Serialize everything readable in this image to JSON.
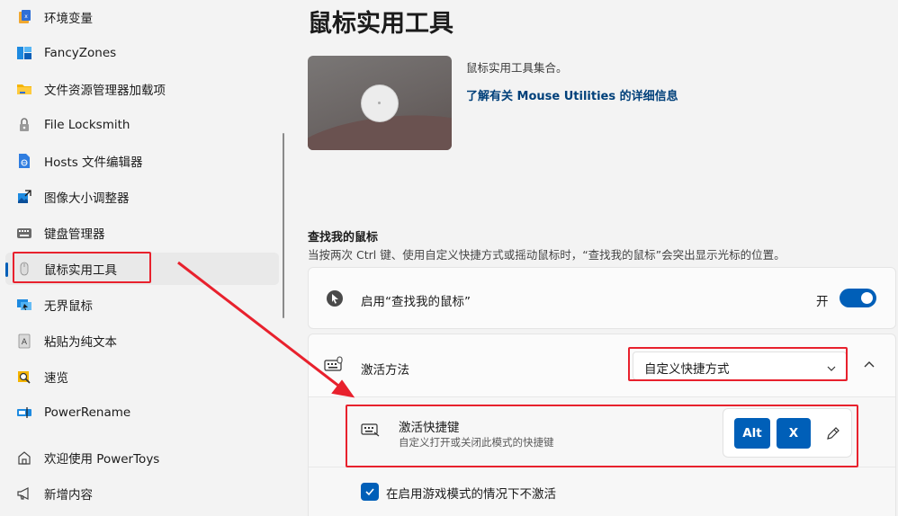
{
  "sidebar": {
    "items": [
      {
        "label": "环境变量",
        "icon": "environment-variables-icon"
      },
      {
        "label": "FancyZones",
        "icon": "fancyzones-icon"
      },
      {
        "label": "文件资源管理器加载项",
        "icon": "file-explorer-addons-icon"
      },
      {
        "label": "File Locksmith",
        "icon": "lock-icon"
      },
      {
        "label": "Hosts 文件编辑器",
        "icon": "hosts-file-icon"
      },
      {
        "label": "图像大小调整器",
        "icon": "image-resizer-icon"
      },
      {
        "label": "键盘管理器",
        "icon": "keyboard-icon"
      },
      {
        "label": "鼠标实用工具",
        "icon": "mouse-icon"
      },
      {
        "label": "无界鼠标",
        "icon": "mouse-without-borders-icon"
      },
      {
        "label": "粘贴为纯文本",
        "icon": "paste-plain-text-icon"
      },
      {
        "label": "速览",
        "icon": "peek-icon"
      },
      {
        "label": "PowerRename",
        "icon": "powerrename-icon"
      },
      {
        "label": "欢迎使用 PowerToys",
        "icon": "welcome-icon"
      },
      {
        "label": "新增内容",
        "icon": "megaphone-icon"
      }
    ],
    "selected_index": 7
  },
  "main": {
    "title": "鼠标实用工具",
    "description": "鼠标实用工具集合。",
    "learn_more": "了解有关 Mouse Utilities 的详细信息",
    "section_title": "查找我的鼠标",
    "section_description": "当按两次 Ctrl 键、使用自定义快捷方式或摇动鼠标时，“查找我的鼠标”会突出显示光标的位置。",
    "enable_label": "启用“查找我的鼠标”",
    "enable_state_label": "开",
    "enabled": true,
    "activation_label": "激活方法",
    "activation_value": "自定义快捷方式",
    "hotkey_title": "激活快捷键",
    "hotkey_description": "自定义打开或关闭此模式的快捷键",
    "hotkey_keys": [
      "Alt",
      "X"
    ],
    "game_mode_label": "在启用游戏模式的情况下不激活",
    "game_mode_checked": true
  },
  "colors": {
    "accent": "#005fb8",
    "annotation_red": "#e8212d",
    "link": "#00407a"
  }
}
